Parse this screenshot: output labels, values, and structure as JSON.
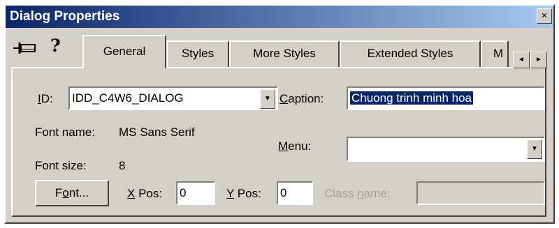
{
  "window": {
    "title": "Dialog Properties",
    "close_glyph": "×"
  },
  "toolbar": {
    "help_glyph": "?"
  },
  "tabs": [
    {
      "label": "General",
      "active": true
    },
    {
      "label": "Styles"
    },
    {
      "label": "More Styles"
    },
    {
      "label": "Extended Styles"
    },
    {
      "label": "M"
    }
  ],
  "tab_scroll": {
    "left": "◄",
    "right": "►"
  },
  "general": {
    "id": {
      "label_u": "I",
      "label_rest": "D:",
      "value": "IDD_C4W6_DIALOG"
    },
    "caption": {
      "label_u": "C",
      "label_rest": "aption:",
      "value": "Chuong trinh minh hoa"
    },
    "font_name": {
      "label": "Font name:",
      "value": "MS Sans Serif"
    },
    "font_size": {
      "label": "Font size:",
      "value": "8"
    },
    "menu": {
      "label_u": "M",
      "label_rest": "enu:",
      "value": ""
    },
    "font_button": {
      "pre": "F",
      "u": "o",
      "post": "nt..."
    },
    "xpos": {
      "label_u": "X",
      "label_rest": " Pos:",
      "value": "0"
    },
    "ypos": {
      "label_u": "Y",
      "label_rest": " Pos:",
      "value": "0"
    },
    "class_name": {
      "pre": "Class ",
      "u": "n",
      "post": "ame:",
      "value": ""
    }
  },
  "dropdown_arrow": "▼"
}
